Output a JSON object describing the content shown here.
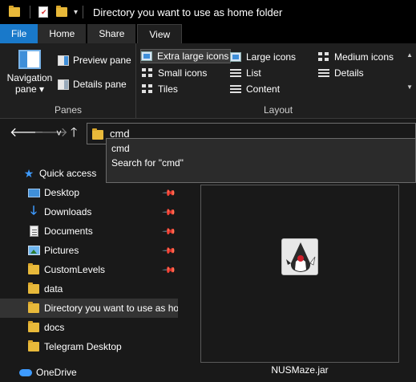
{
  "window": {
    "title": "Directory you want to use as home folder",
    "qa_dropdown": "▾"
  },
  "tabs": [
    "File",
    "Home",
    "Share",
    "View"
  ],
  "ribbon": {
    "panes": {
      "group_label": "Panes",
      "navigation_pane": "Navigation pane ▾",
      "preview_pane": "Preview pane",
      "details_pane": "Details pane"
    },
    "layout": {
      "group_label": "Layout",
      "items": [
        {
          "label": "Extra large icons",
          "icon": "extra-large-icons-icon",
          "selected": true
        },
        {
          "label": "Large icons",
          "icon": "large-icons-icon"
        },
        {
          "label": "Medium icons",
          "icon": "medium-icons-icon"
        },
        {
          "label": "Small icons",
          "icon": "small-icons-icon"
        },
        {
          "label": "List",
          "icon": "list-icon"
        },
        {
          "label": "Details",
          "icon": "details-icon"
        },
        {
          "label": "Tiles",
          "icon": "tiles-icon"
        },
        {
          "label": "Content",
          "icon": "content-icon"
        }
      ]
    }
  },
  "address": {
    "value": "cmd",
    "back": "🡐",
    "forward": "🡒",
    "recent": "˅",
    "up": "🡑"
  },
  "suggestions": [
    "cmd",
    "Search for \"cmd\""
  ],
  "nav": {
    "items": [
      {
        "label": "Quick access",
        "icon": "star-icon"
      },
      {
        "label": "Desktop",
        "icon": "desktop-icon",
        "pinned": true
      },
      {
        "label": "Downloads",
        "icon": "download-icon",
        "pinned": true
      },
      {
        "label": "Documents",
        "icon": "documents-icon",
        "pinned": true
      },
      {
        "label": "Pictures",
        "icon": "pictures-icon",
        "pinned": true
      },
      {
        "label": "CustomLevels",
        "icon": "folder-icon",
        "pinned": true
      },
      {
        "label": "data",
        "icon": "folder-icon"
      },
      {
        "label": "Directory you want to use as home folder",
        "icon": "folder-icon",
        "selected": true
      },
      {
        "label": "docs",
        "icon": "folder-icon"
      },
      {
        "label": "Telegram Desktop",
        "icon": "folder-icon"
      },
      {
        "label": "OneDrive",
        "icon": "onedrive-icon"
      }
    ]
  },
  "content": {
    "file_name": "NUSMaze.jar",
    "file_icon": "java-jar-icon"
  }
}
